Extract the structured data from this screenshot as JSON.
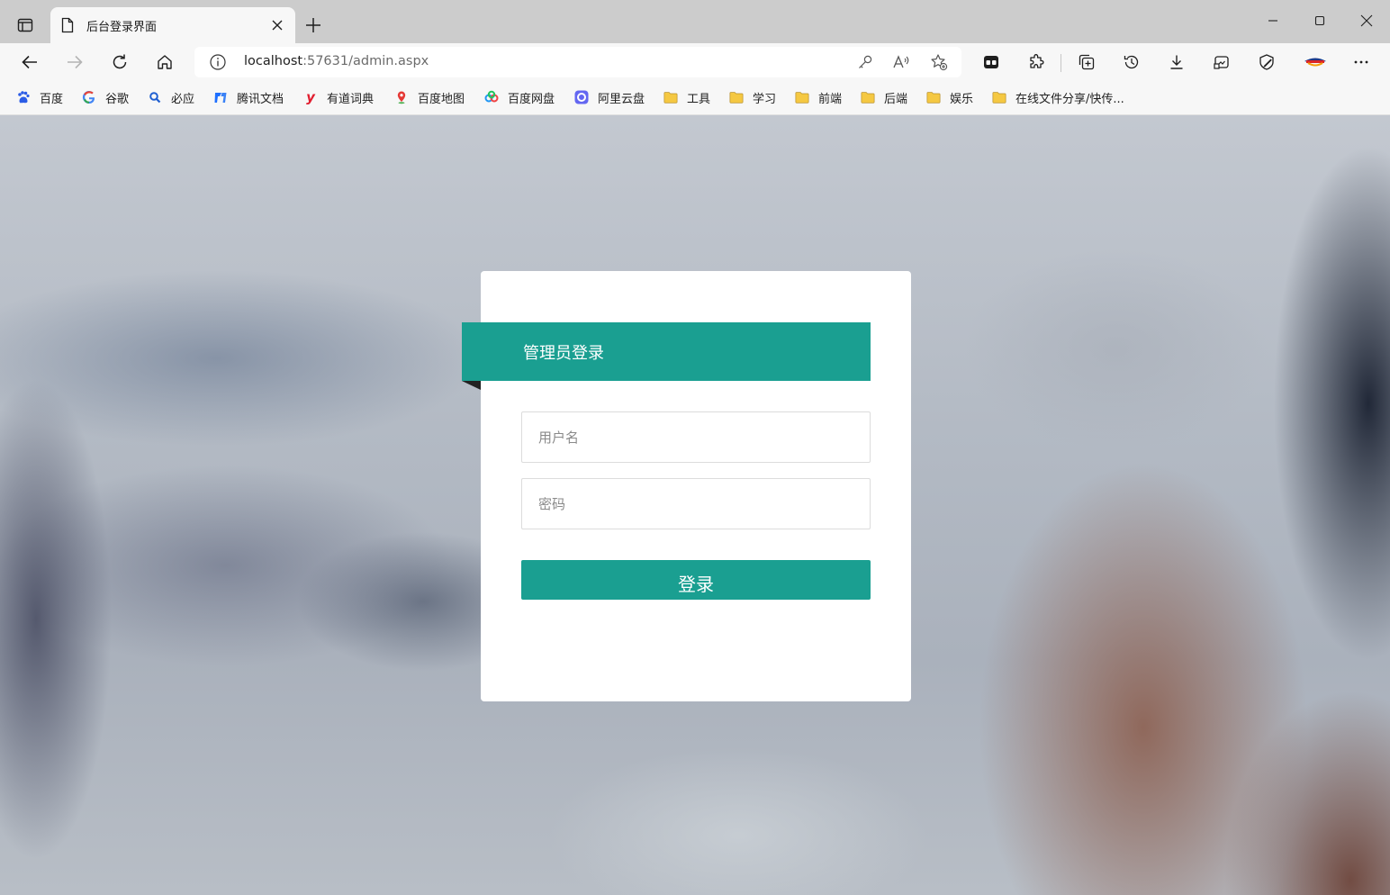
{
  "browser": {
    "tab": {
      "title": "后台登录界面"
    },
    "address": {
      "host": "localhost",
      "path": ":57631/admin.aspx"
    },
    "bookmarks": [
      {
        "label": "百度",
        "icon": "baidu-icon"
      },
      {
        "label": "谷歌",
        "icon": "google-icon"
      },
      {
        "label": "必应",
        "icon": "bing-icon"
      },
      {
        "label": "腾讯文档",
        "icon": "tencent-docs-icon"
      },
      {
        "label": "有道词典",
        "icon": "youdao-icon"
      },
      {
        "label": "百度地图",
        "icon": "baidu-map-icon"
      },
      {
        "label": "百度网盘",
        "icon": "baidu-netdisk-icon"
      },
      {
        "label": "阿里云盘",
        "icon": "aliyun-drive-icon"
      },
      {
        "label": "工具",
        "icon": "folder-icon"
      },
      {
        "label": "学习",
        "icon": "folder-icon"
      },
      {
        "label": "前端",
        "icon": "folder-icon"
      },
      {
        "label": "后端",
        "icon": "folder-icon"
      },
      {
        "label": "娱乐",
        "icon": "folder-icon"
      },
      {
        "label": "在线文件分享/快传...",
        "icon": "folder-icon"
      }
    ]
  },
  "login": {
    "heading": "管理员登录",
    "username_placeholder": "用户名",
    "password_placeholder": "密码",
    "submit_label": "登录"
  },
  "colors": {
    "accent": "#1a9f91",
    "card": "#ffffff",
    "tabstrip": "#cccccc",
    "toolbar": "#f7f7f7",
    "folder": "#f5c842"
  }
}
